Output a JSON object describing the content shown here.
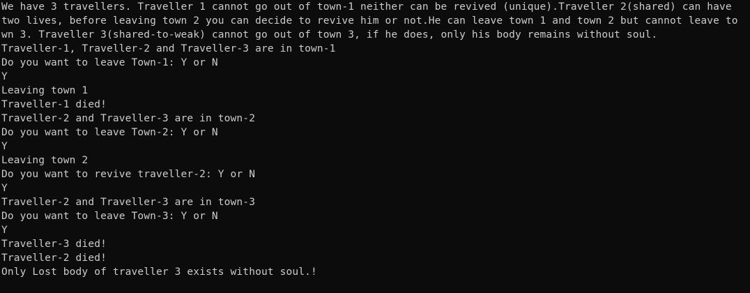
{
  "console": {
    "lines": [
      "We have 3 travellers. Traveller 1 cannot go out of town-1 neither can be revived (unique).Traveller 2(shared) can have",
      "two lives, before leaving town 2 you can decide to revive him or not.He can leave town 1 and town 2 but cannot leave to",
      "wn 3. Traveller 3(shared-to-weak) cannot go out of town 3, if he does, only his body remains without soul.",
      "Traveller-1, Traveller-2 and Traveller-3 are in town-1",
      "Do you want to leave Town-1: Y or N",
      "Y",
      "Leaving town 1",
      "Traveller-1 died!",
      "Traveller-2 and Traveller-3 are in town-2",
      "Do you want to leave Town-2: Y or N",
      "Y",
      "Leaving town 2",
      "Do you want to revive traveller-2: Y or N",
      "Y",
      "Traveller-2 and Traveller-3 are in town-3",
      "Do you want to leave Town-3: Y or N",
      "Y",
      "Traveller-3 died!",
      "Traveller-2 died!",
      "Only Lost body of traveller 3 exists without soul.!"
    ]
  }
}
